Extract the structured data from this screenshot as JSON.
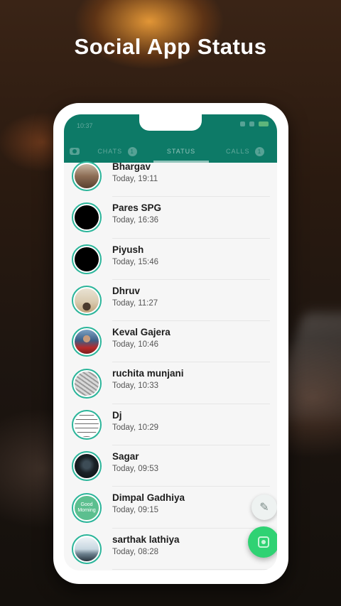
{
  "headline": "Social App Status",
  "colors": {
    "accent": "#0d7a67",
    "ring": "#2bb59a",
    "fab": "#2fd273"
  },
  "status_bar": {
    "time": "10:37"
  },
  "tabs": [
    {
      "label": "CHATS",
      "count": "1"
    },
    {
      "label": "STATUS"
    },
    {
      "label": "CALLS",
      "count": "1"
    }
  ],
  "statuses": [
    {
      "name": "Bhargav",
      "time": "Today, 19:11"
    },
    {
      "name": "Pares SPG",
      "time": "Today, 16:36"
    },
    {
      "name": "Piyush",
      "time": "Today, 15:46"
    },
    {
      "name": "Dhruv",
      "time": "Today, 11:27"
    },
    {
      "name": "Keval Gajera",
      "time": "Today, 10:46"
    },
    {
      "name": "ruchita munjani",
      "time": "Today, 10:33"
    },
    {
      "name": "Dj",
      "time": "Today, 10:29"
    },
    {
      "name": "Sagar",
      "time": "Today, 09:53"
    },
    {
      "name": "Dimpal Gadhiya",
      "time": "Today, 09:15",
      "avatar_text": "Good Morning"
    },
    {
      "name": "sarthak lathiya",
      "time": "Today, 08:28"
    }
  ],
  "icons": {
    "camera": "camera-icon",
    "pencil": "pencil-icon",
    "status_fab": "status-camera-icon"
  }
}
